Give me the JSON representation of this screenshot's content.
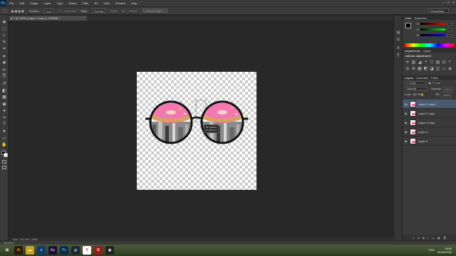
{
  "app": {
    "logo": "Ps"
  },
  "menu": [
    "File",
    "Edit",
    "Image",
    "Layer",
    "Type",
    "Select",
    "Filter",
    "3D",
    "View",
    "Window",
    "Help"
  ],
  "options": {
    "feather_label": "Feather:",
    "feather_value": "0 px",
    "antialias_label": "Anti-alias",
    "style_label": "Style:",
    "style_value": "Normal",
    "width_label": "Width:",
    "height_label": "Height:",
    "refine_label": "Refine Edge...",
    "workspace": "Essentials"
  },
  "document": {
    "tab_title": "● 1 @ 100% (Layer 2 copy 2, RGB/8) *",
    "status": "Doc: 732,4K/1,16M",
    "transform_readout": {
      "w": "W: 2,28 cm",
      "h": "H: 0,87 cm"
    }
  },
  "window_controls": [
    "–",
    "□",
    "×"
  ],
  "tools": [
    "move-tool",
    "marquee-tool",
    "lasso-tool",
    "quick-select-tool",
    "crop-tool",
    "eyedropper-tool",
    "healing-tool",
    "brush-tool",
    "clone-tool",
    "history-brush-tool",
    "eraser-tool",
    "gradient-tool",
    "blur-tool",
    "dodge-tool",
    "pen-tool",
    "type-tool",
    "path-select-tool",
    "shape-tool",
    "hand-tool",
    "zoom-tool"
  ],
  "tool_glyphs": [
    "✥",
    "⬚",
    "ʟ",
    "✎",
    "⌗",
    "✒",
    "✚",
    "✏",
    "⎘",
    "↺",
    "◧",
    "▦",
    "◉",
    "●",
    "✑",
    "T",
    "➤",
    "▭",
    "✋",
    "⌕"
  ],
  "colors": {
    "foreground": "#000000",
    "background": "#ffffff",
    "donut_pink": "#ef5f9e",
    "selected_layer": "#4a5a6e"
  },
  "color_panel": {
    "tabs": [
      "Color",
      "Swatches"
    ],
    "sliders": [
      {
        "letter": "R",
        "gradient": "linear-gradient(to right,#000,#f00)"
      },
      {
        "letter": "G",
        "gradient": "linear-gradient(to right,#000,#0f0)"
      },
      {
        "letter": "B",
        "gradient": "linear-gradient(to right,#000,#00f)"
      }
    ]
  },
  "adjustments_panel": {
    "tabs": [
      "Adjustments",
      "Styles"
    ],
    "heading": "Add an adjustment",
    "icons": [
      "brightness-icon",
      "levels-icon",
      "curves-icon",
      "exposure-icon",
      "vibrance-icon",
      "hue-icon",
      "balance-icon",
      "bw-icon",
      "photofilter-icon",
      "mixer-icon",
      "lookup-icon",
      "invert-icon",
      "posterize-icon",
      "threshold-icon",
      "gradientmap-icon",
      "selectivecolor-icon"
    ],
    "icon_glyphs": [
      "☀",
      "▥",
      "◢",
      "◑",
      "▽",
      "▤",
      "⚖",
      "◐",
      "◎",
      "⊕",
      "▦",
      "◩",
      "◪",
      "◫",
      "▭",
      "◈"
    ]
  },
  "layers_panel": {
    "tabs": [
      "Layers",
      "Channels",
      "Paths"
    ],
    "kind_label": "Kind",
    "blend_mode": "Normal",
    "opacity_label": "Opacity:",
    "opacity_value": "100%",
    "lock_label": "Lock:",
    "fill_label": "Fill:",
    "fill_value": "100%",
    "layers": [
      {
        "name": "Layer 2 copy 2",
        "selected": true
      },
      {
        "name": "Layer 2 copy",
        "selected": false
      },
      {
        "name": "Layer 4 copy",
        "selected": false
      },
      {
        "name": "Layer 4",
        "selected": false
      },
      {
        "name": "Layer 2",
        "selected": false
      }
    ]
  },
  "timeline_label": "Timeline",
  "taskbar": {
    "icons": [
      {
        "name": "windows-start-icon",
        "glyph": "⊞",
        "bg": "transparent",
        "fg": "#ffffff"
      },
      {
        "name": "illustrator-icon",
        "glyph": "Ai",
        "bg": "#2b1a00",
        "fg": "#ff9a00"
      },
      {
        "name": "file-explorer-icon",
        "glyph": "▬",
        "bg": "#c9a227",
        "fg": "#fff5c0"
      },
      {
        "name": "edge-icon",
        "glyph": "e",
        "bg": "#0d3b6e",
        "fg": "#9ed3ff"
      },
      {
        "name": "after-effects-icon",
        "glyph": "Ae",
        "bg": "#1a1030",
        "fg": "#c7a2ff"
      },
      {
        "name": "photoshop-icon",
        "glyph": "Ps",
        "bg": "#0f2a44",
        "fg": "#3fa9f5"
      },
      {
        "name": "steam-icon",
        "glyph": "◎",
        "bg": "#1b2838",
        "fg": "#c7d5e0"
      },
      {
        "name": "yandex-icon",
        "glyph": "Y",
        "bg": "#ffffff",
        "fg": "#ff0000"
      },
      {
        "name": "opera-icon",
        "glyph": "O",
        "bg": "#9a1b1b",
        "fg": "#ffffff"
      },
      {
        "name": "obs-icon",
        "glyph": "◉",
        "bg": "#222222",
        "fg": "#dddddd"
      }
    ],
    "time": "19:52",
    "date": "30.06.2015",
    "lang": "РУС"
  }
}
